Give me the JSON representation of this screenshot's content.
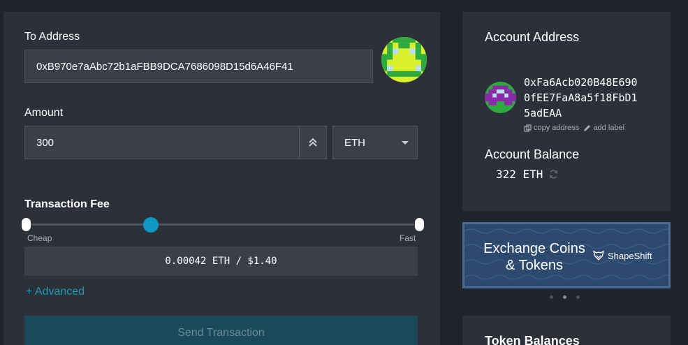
{
  "send_form": {
    "to_address_label": "To Address",
    "to_address_value": "0xB970e7aAbc72b1aFBB9DCA7686098D15d6A46F41",
    "amount_label": "Amount",
    "amount_value": "300",
    "unit_selected": "ETH",
    "fee_label": "Transaction Fee",
    "fee_cheap": "Cheap",
    "fee_fast": "Fast",
    "fee_value": "0.00042 ETH / $1.40",
    "fee_level": 0.32,
    "advanced_label": "+ Advanced",
    "send_button": "Send Transaction"
  },
  "account": {
    "address_label": "Account Address",
    "address": "0xFa6Acb020B48E6900fEE7FaA8a5f18FbD15adEAA",
    "copy_label": "copy address",
    "add_label": "add label",
    "balance_label": "Account Balance",
    "balance_value": "322 ETH"
  },
  "banner": {
    "title": "Exchange Coins & Tokens",
    "brand": "ShapeShift"
  },
  "token_balances_label": "Token Balances",
  "colors": {
    "accent": "#0e97c0",
    "link": "#1b9bb3",
    "panel": "#2b3039",
    "input": "#3a3f4a",
    "background": "#1f242c"
  },
  "icons": [
    "identicon",
    "chevron-double-up-icon",
    "chevron-down-icon",
    "copy-icon",
    "pencil-icon",
    "refresh-icon",
    "fox-icon"
  ]
}
